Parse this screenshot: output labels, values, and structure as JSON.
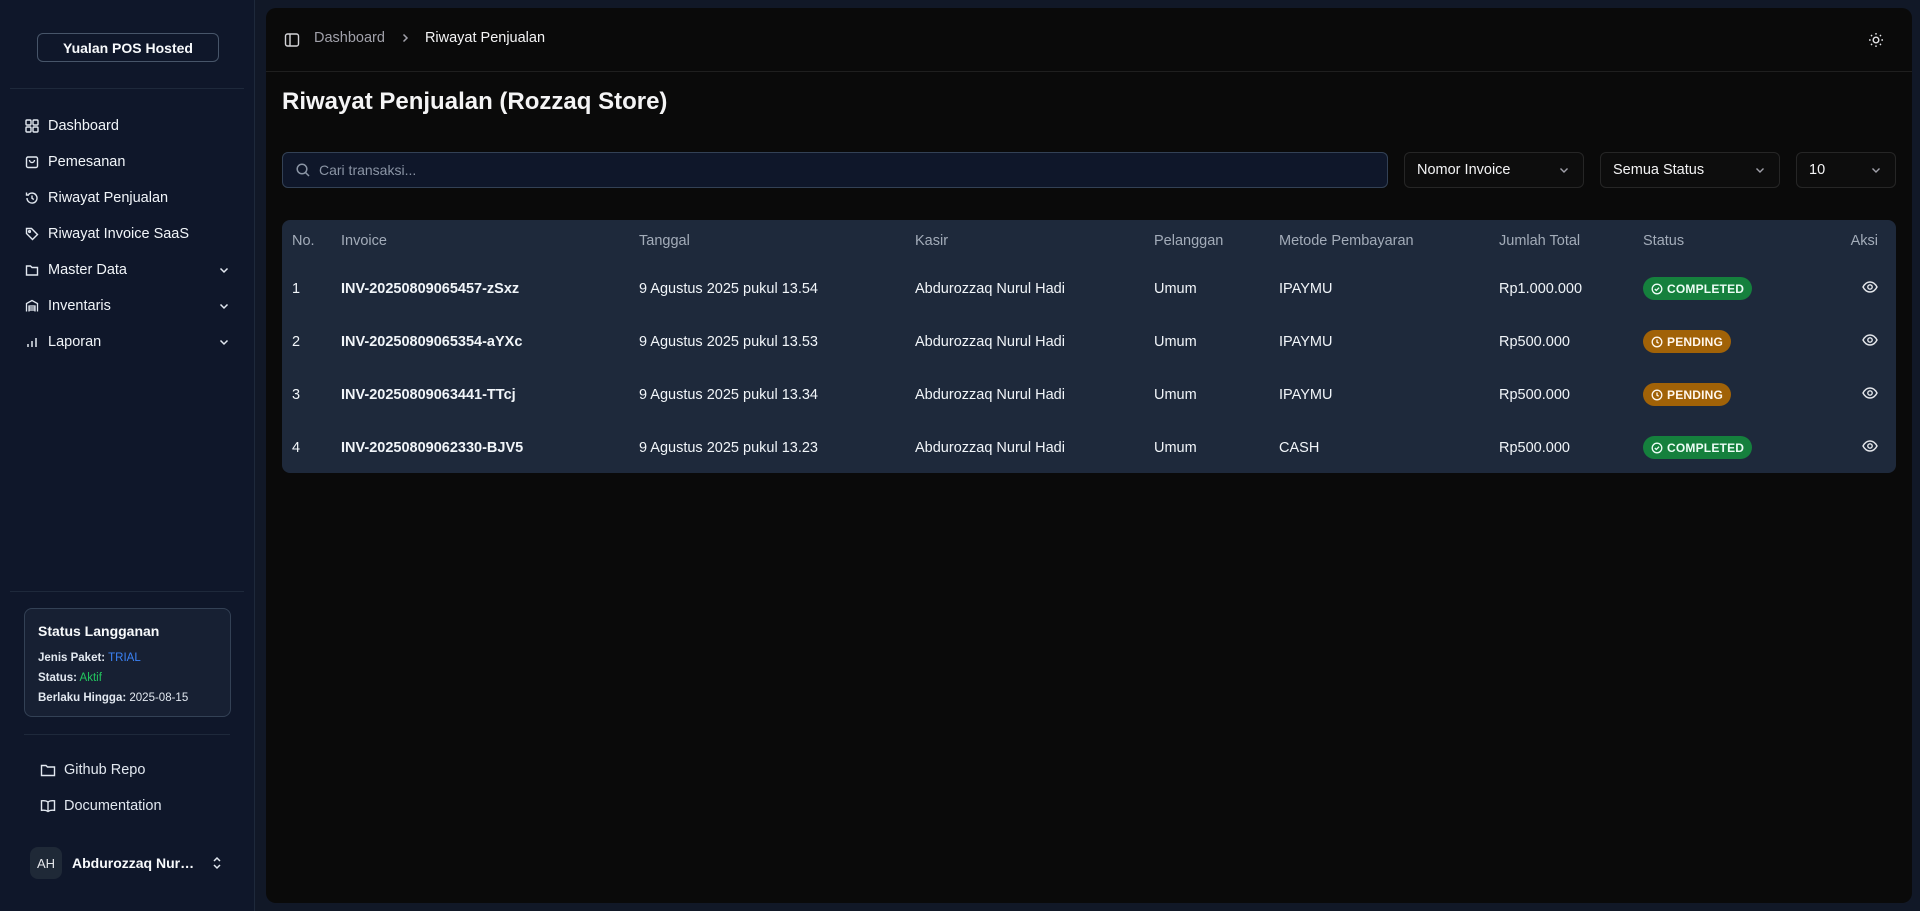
{
  "sidebar": {
    "brand": "Yualan POS Hosted",
    "items": [
      {
        "label": "Dashboard",
        "icon": "grid-icon"
      },
      {
        "label": "Pemesanan",
        "icon": "shopping-bag-icon"
      },
      {
        "label": "Riwayat Penjualan",
        "icon": "history-icon"
      },
      {
        "label": "Riwayat Invoice SaaS",
        "icon": "tag-icon"
      },
      {
        "label": "Master Data",
        "icon": "folder-icon"
      },
      {
        "label": "Inventaris",
        "icon": "warehouse-icon"
      },
      {
        "label": "Laporan",
        "icon": "bar-chart-icon"
      }
    ],
    "subscription": {
      "title": "Status Langganan",
      "plan_label": "Jenis Paket:",
      "plan_value": "TRIAL",
      "status_label": "Status:",
      "status_value": "Aktif",
      "valid_label": "Berlaku Hingga:",
      "valid_value": "2025-08-15"
    },
    "footer_links": [
      {
        "label": "Github Repo",
        "icon": "folder-icon"
      },
      {
        "label": "Documentation",
        "icon": "book-icon"
      }
    ],
    "user": {
      "initials": "AH",
      "name": "Abdurozzaq Nurul Hadi"
    }
  },
  "header": {
    "breadcrumb_1": "Dashboard",
    "breadcrumb_2": "Riwayat Penjualan"
  },
  "page": {
    "title": "Riwayat Penjualan (Rozzaq Store)",
    "search_placeholder": "Cari transaksi...",
    "filter_field": "Nomor Invoice",
    "filter_status": "Semua Status",
    "per_page": "10"
  },
  "table": {
    "headers": [
      "No.",
      "Invoice",
      "Tanggal",
      "Kasir",
      "Pelanggan",
      "Metode Pembayaran",
      "Jumlah Total",
      "Status",
      "Aksi"
    ],
    "rows": [
      {
        "no": "1",
        "invoice": "INV-20250809065457-zSxz",
        "date": "9 Agustus 2025 pukul 13.54",
        "cashier": "Abdurozzaq Nurul Hadi",
        "customer": "Umum",
        "method": "IPAYMU",
        "total": "Rp1.000.000",
        "status": "COMPLETED"
      },
      {
        "no": "2",
        "invoice": "INV-20250809065354-aYXc",
        "date": "9 Agustus 2025 pukul 13.53",
        "cashier": "Abdurozzaq Nurul Hadi",
        "customer": "Umum",
        "method": "IPAYMU",
        "total": "Rp500.000",
        "status": "PENDING"
      },
      {
        "no": "3",
        "invoice": "INV-20250809063441-TTcj",
        "date": "9 Agustus 2025 pukul 13.34",
        "cashier": "Abdurozzaq Nurul Hadi",
        "customer": "Umum",
        "method": "IPAYMU",
        "total": "Rp500.000",
        "status": "PENDING"
      },
      {
        "no": "4",
        "invoice": "INV-20250809062330-BJV5",
        "date": "9 Agustus 2025 pukul 13.23",
        "cashier": "Abdurozzaq Nurul Hadi",
        "customer": "Umum",
        "method": "CASH",
        "total": "Rp500.000",
        "status": "COMPLETED"
      }
    ]
  },
  "colors": {
    "completed": "#15803d",
    "pending": "#a16207",
    "trial": "#3b82f6",
    "aktif": "#22c55e"
  }
}
